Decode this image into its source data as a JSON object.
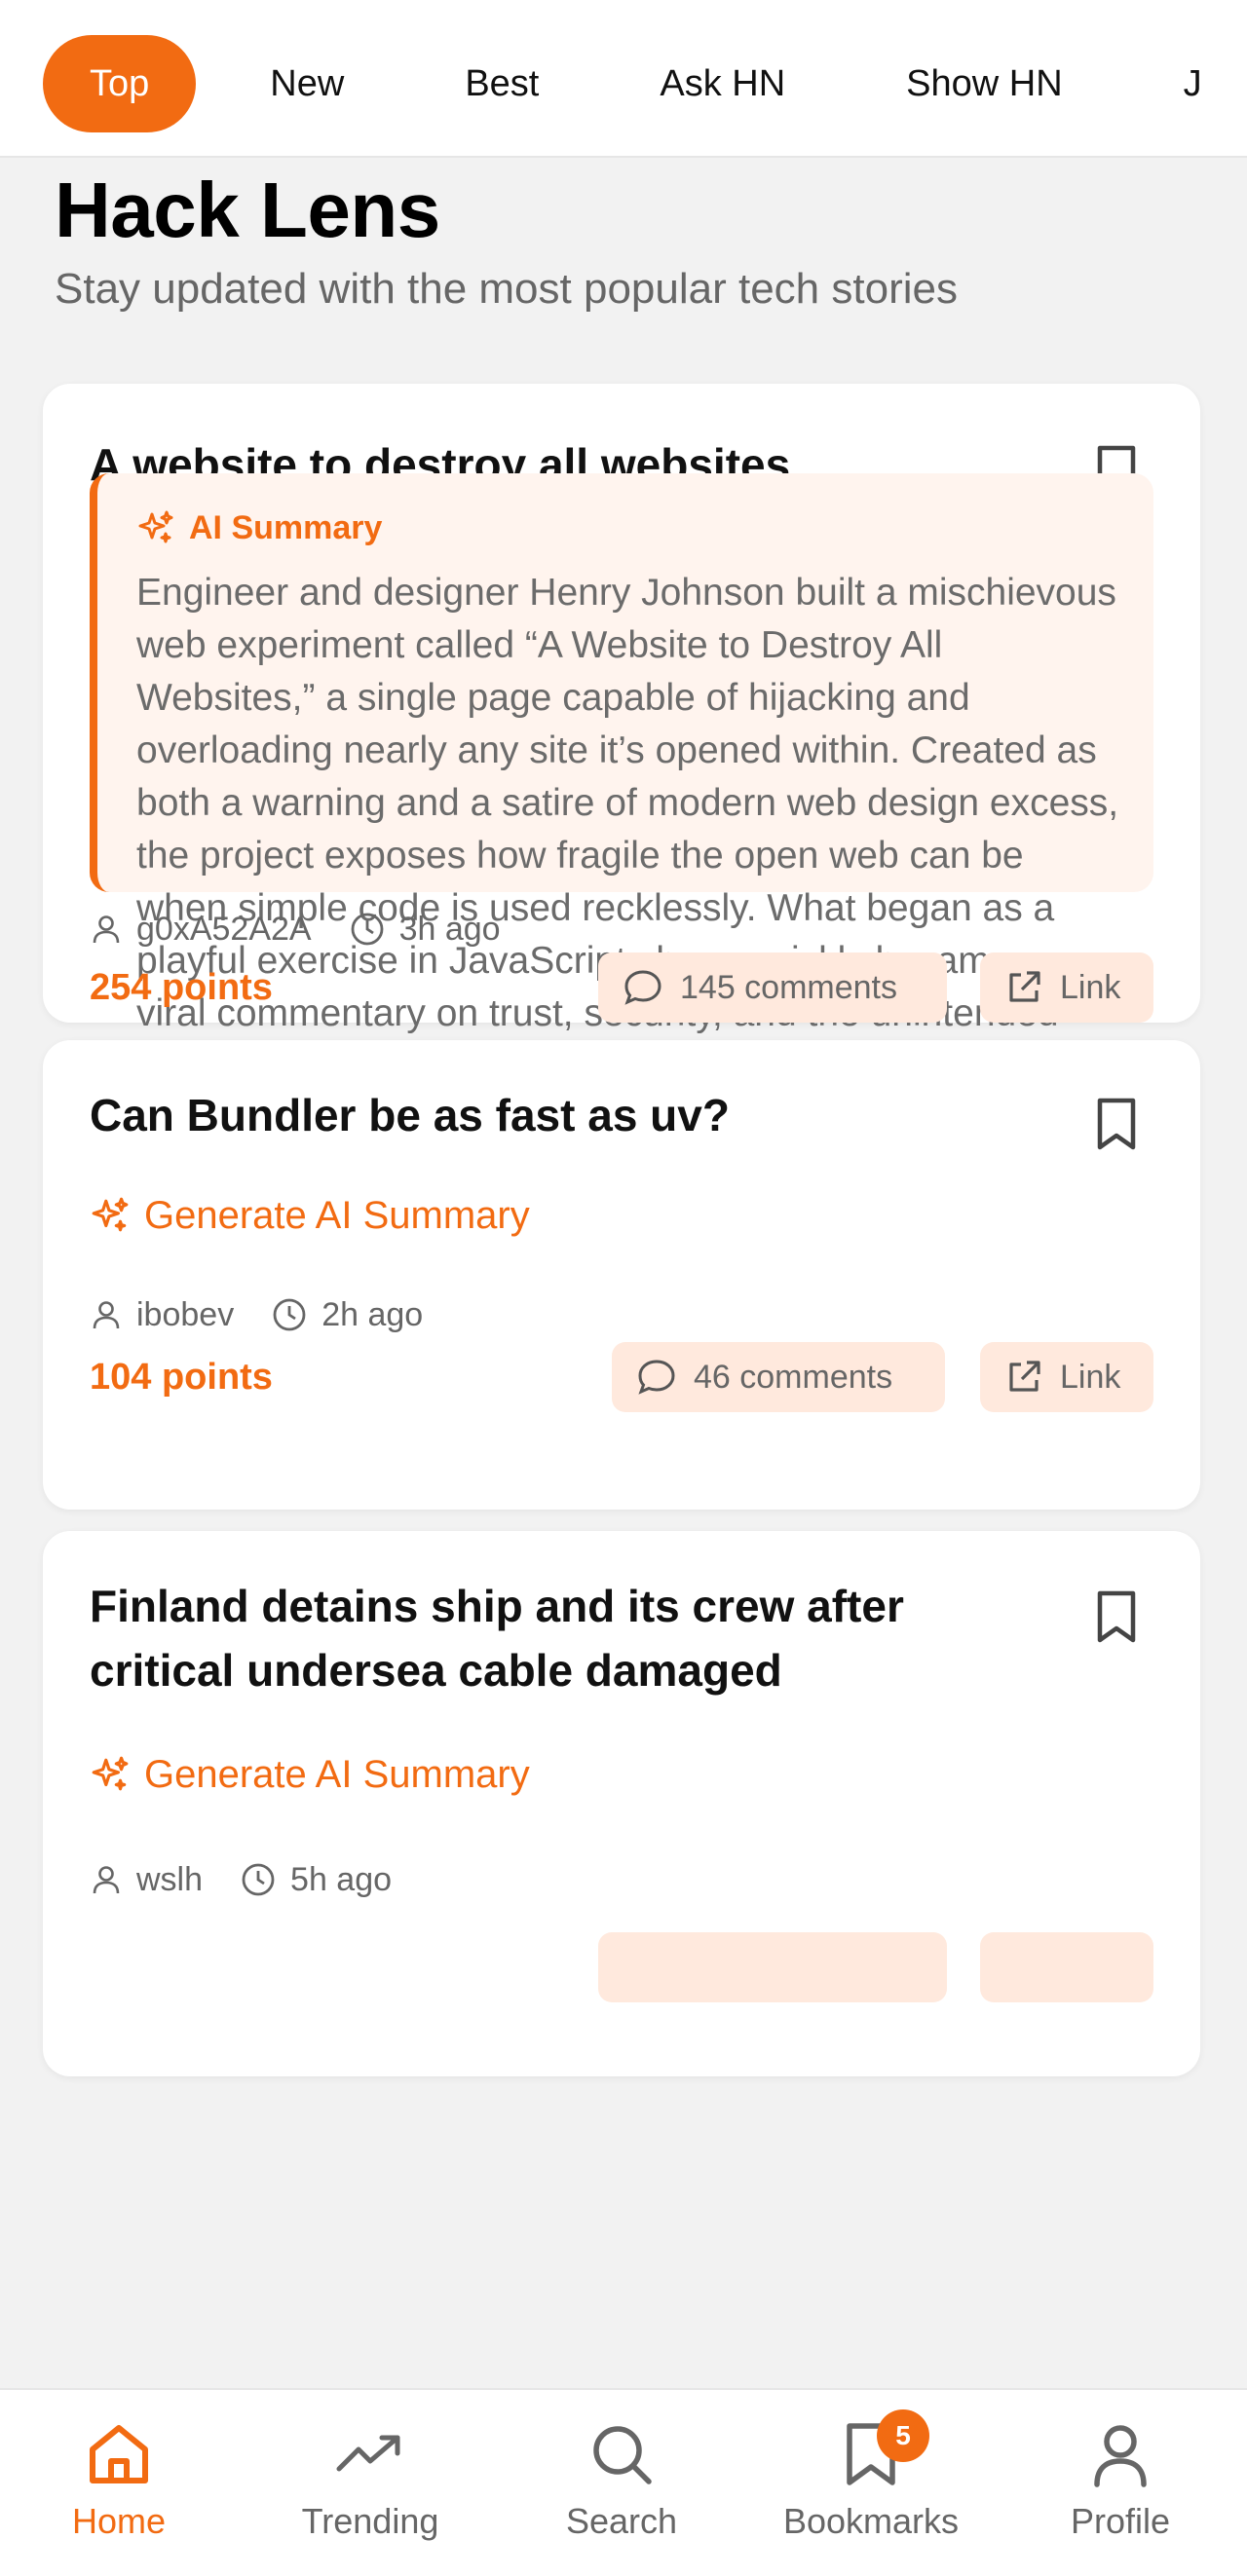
{
  "tabs": [
    {
      "label": "Top",
      "active": true
    },
    {
      "label": "New"
    },
    {
      "label": "Best"
    },
    {
      "label": "Ask HN"
    },
    {
      "label": "Show HN"
    },
    {
      "label": "J"
    }
  ],
  "header": {
    "title": "Hack Lens",
    "subtitle": "Stay updated with the most popular tech stories"
  },
  "stories": [
    {
      "title": "A website to destroy all websites",
      "summary_label": "AI Summary",
      "summary": "Engineer and designer Henry Johnson built a mischievous web experiment called “A Website to Destroy All Websites,” a single page capable of hijacking and overloading nearly any site it’s opened within. Created as both a warning and a satire of modern web design excess, the project exposes how fragile the open web can be when simple code is used recklessly. What began as a playful exercise in JavaScript chaos quickly became a viral commentary on trust, security, and the unintended consequences of creativity online.",
      "author": "g0xA52A2A",
      "time": "3h ago",
      "points": "254 points",
      "comments": "145 comments",
      "link_label": "Link"
    },
    {
      "title": "Can Bundler be as fast as uv?",
      "generate_label": "Generate AI Summary",
      "author": "ibobev",
      "time": "2h ago",
      "points": "104 points",
      "comments": "46 comments",
      "link_label": "Link"
    },
    {
      "title": "Finland detains ship and its crew after critical undersea cable damaged",
      "generate_label": "Generate AI Summary",
      "author": "wslh",
      "time": "5h ago"
    }
  ],
  "nav": [
    {
      "label": "Home",
      "icon": "home-icon",
      "active": true
    },
    {
      "label": "Trending",
      "icon": "trending-icon"
    },
    {
      "label": "Search",
      "icon": "search-icon"
    },
    {
      "label": "Bookmarks",
      "icon": "bookmark-icon",
      "badge": "5"
    },
    {
      "label": "Profile",
      "icon": "profile-icon"
    }
  ],
  "colors": {
    "accent": "#f26b12",
    "accent_soft": "#ffe9dd",
    "summary_bg": "#fff4ee",
    "background": "#f2f2f2"
  }
}
